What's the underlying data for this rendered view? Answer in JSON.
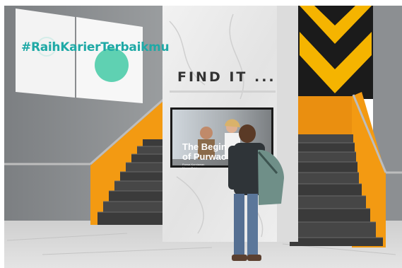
{
  "scene": {
    "poster_text": "#RaihKarierTerbaikmu",
    "pillar_text": "FIND IT ...",
    "screen_title_line1": "The Begin",
    "screen_title_line2": "of Purwac",
    "screen_subtitle_line1": "Purwa Kurniawan",
    "screen_subtitle_line2": "Maura Putri",
    "colors": {
      "accent_orange": "#f39a12",
      "accent_yellow": "#f5b400",
      "teal_text": "#1fa9a6",
      "mint_circle": "#5fd1b2",
      "wall_gray": "#8a8d90",
      "floor": "#d8d8d8",
      "marble": "#eeeeee"
    }
  }
}
